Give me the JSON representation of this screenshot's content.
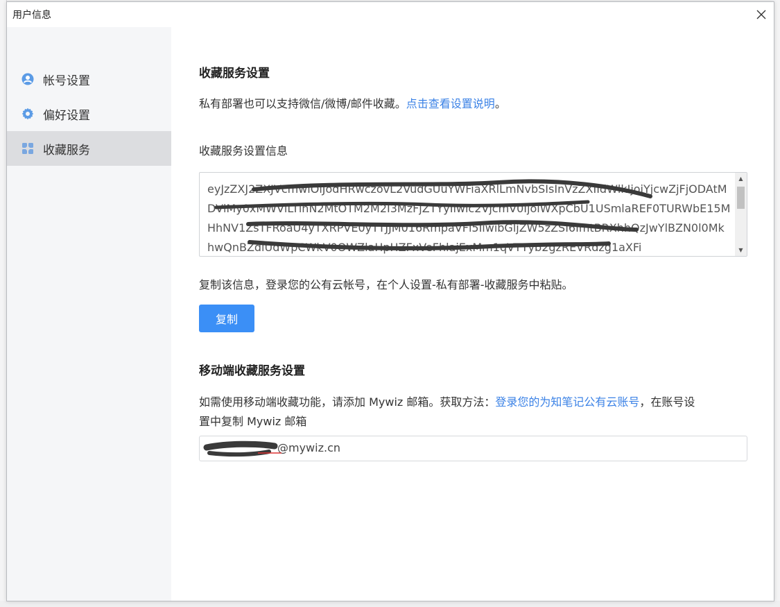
{
  "window": {
    "title": "用户信息"
  },
  "sidebar": {
    "items": [
      {
        "label": "帐号设置",
        "icon": "user-icon",
        "active": false
      },
      {
        "label": "偏好设置",
        "icon": "gear-icon",
        "active": false
      },
      {
        "label": "收藏服务",
        "icon": "collection-icon",
        "active": true
      }
    ]
  },
  "favorites_service": {
    "heading": "收藏服务设置",
    "description_prefix": "私有部署也可以支持微信/微博/邮件收藏。",
    "description_link": "点击查看设置说明",
    "description_suffix": "。",
    "info_label": "收藏服务设置信息",
    "token_text": "eyJzZXJ2ZXJVcmwiOiJodHRwczovL2VudGUuYWFiaXRlLmNvbSIsInVzZXIIdWlkIjoiYjcwZjFjODAtMDVlMy0xMWVlLTlhN2MtOTM2M2I3MzFjZTYyIiwic2VjcmV0IjoiWXpCbU1USmlaREF0TURWbE15MHhNV1ZsTFRoaU4yTXRPVE0yTTJJM016RmpaVFl5IiwibGljZW5zZSI6ImtBRXhhQzJwYlBZN0l0MkhwQnBZdlUdWpCWkV0OWZlaHpHZFxVeFhlajExMm1qVTYyb2gzREVRdzg1aXFi",
    "copy_hint": "复制该信息，登录您的公有云帐号，在个人设置-私有部署-收藏服务中粘贴。",
    "copy_button": "复制"
  },
  "mobile_service": {
    "heading": "移动端收藏服务设置",
    "line1_prefix": "如需使用移动端收藏功能，请添加 Mywiz 邮箱。获取方法：",
    "line1_link": "登录您的为知笔记公有云账号",
    "line1_suffix": "，在账号设",
    "line2": "置中复制 Mywiz 邮箱",
    "email_value": "@mywiz.cn"
  },
  "colors": {
    "accent": "#3b8ff6",
    "link": "#3b82e6",
    "sidebar_bg": "#f5f6f8",
    "sidebar_active": "#dcdde0",
    "icon": "#4a90e2"
  }
}
